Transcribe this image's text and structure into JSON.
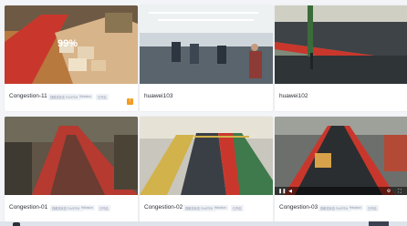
{
  "cameras": [
    {
      "name": "Congestion-11",
      "meta": [
        "视频流状态 FLV/RTMP",
        "Hikvision",
        "已开启"
      ],
      "has_alert": true,
      "alert_icon": "alert-icon"
    },
    {
      "name": "huawei103",
      "meta": [],
      "has_alert": false
    },
    {
      "name": "huawei102",
      "meta": [],
      "has_alert": false
    },
    {
      "name": "Congestion-01",
      "meta": [
        "视频流状态 FLV/RTMP",
        "Hikvision",
        "已开启"
      ],
      "has_alert": false
    },
    {
      "name": "Congestion-02",
      "meta": [
        "视频流状态 FLV/RTMP",
        "Hikvision",
        "已开启"
      ],
      "has_alert": false
    },
    {
      "name": "Congestion-03",
      "meta": [
        "视频流状态 FLV/RTMP",
        "Hikvision",
        "已开启"
      ],
      "has_alert": false,
      "player": {
        "icons": [
          "pause-icon",
          "volume-icon",
          "fullscreen-icon",
          "settings-icon"
        ]
      }
    }
  ],
  "colors": {
    "accent": "#f59a23",
    "card_bg": "#ffffff",
    "page_bg": "#f2f4f7"
  }
}
